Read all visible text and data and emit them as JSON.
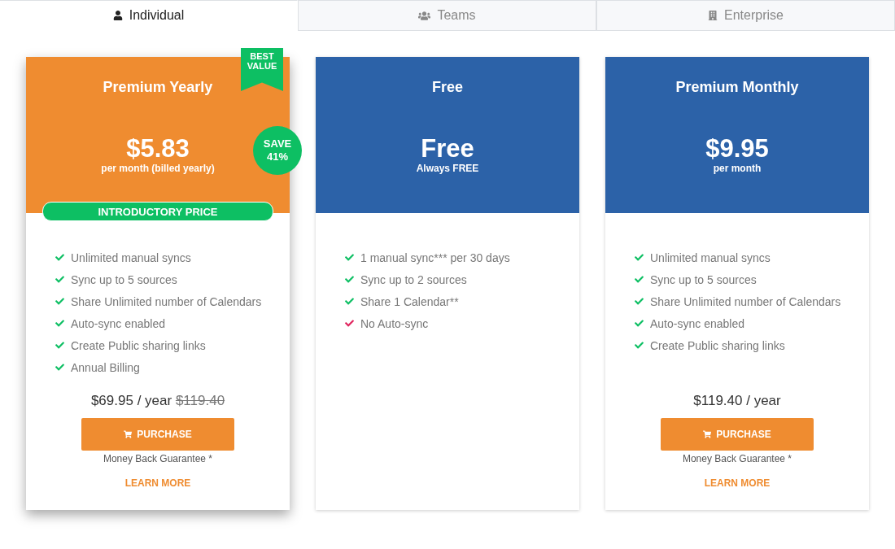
{
  "tabs": [
    {
      "label": "Individual",
      "kind": "person",
      "selected": true
    },
    {
      "label": "Teams",
      "kind": "group",
      "selected": false
    },
    {
      "label": "Enterprise",
      "kind": "building",
      "selected": false
    }
  ],
  "plans": [
    {
      "title": "Premium Yearly",
      "featured": true,
      "color": "#ef8c30",
      "ribbon": "BEST\nVALUE",
      "badge": "SAVE\n41%",
      "price": "$5.83",
      "price_note": "per month (billed yearly)",
      "banner": "INTRODUCTORY PRICE",
      "features": [
        {
          "text": "Unlimited manual syncs",
          "included": true
        },
        {
          "text": "Sync up to 5 sources",
          "included": true
        },
        {
          "text": "Share Unlimited number of Calendars",
          "included": true
        },
        {
          "text": "Auto-sync enabled",
          "included": true
        },
        {
          "text": "Create Public sharing links",
          "included": true
        },
        {
          "text": "Annual Billing",
          "included": true
        }
      ],
      "total": "$69.95 / year",
      "old_total": "$119.40",
      "button": "PURCHASE",
      "guarantee": "Money Back Guarantee *",
      "link": "LEARN MORE"
    },
    {
      "title": "Free",
      "featured": false,
      "color": "#2c62a8",
      "price": "Free",
      "price_note": "Always FREE",
      "features": [
        {
          "text": "1 manual sync*** per 30 days",
          "included": true
        },
        {
          "text": "Sync up to 2 sources",
          "included": true
        },
        {
          "text": "Share 1 Calendar**",
          "included": true
        },
        {
          "text": "No Auto-sync",
          "included": false
        }
      ]
    },
    {
      "title": "Premium Monthly",
      "featured": false,
      "color": "#2c62a8",
      "price": "$9.95",
      "price_note": "per month",
      "features": [
        {
          "text": "Unlimited manual syncs",
          "included": true
        },
        {
          "text": "Sync up to 5 sources",
          "included": true
        },
        {
          "text": "Share Unlimited number of Calendars",
          "included": true
        },
        {
          "text": "Auto-sync enabled",
          "included": true
        },
        {
          "text": "Create Public sharing links",
          "included": true
        }
      ],
      "total": "$119.40 / year",
      "button": "PURCHASE",
      "guarantee": "Money Back Guarantee *",
      "link": "LEARN MORE"
    }
  ]
}
